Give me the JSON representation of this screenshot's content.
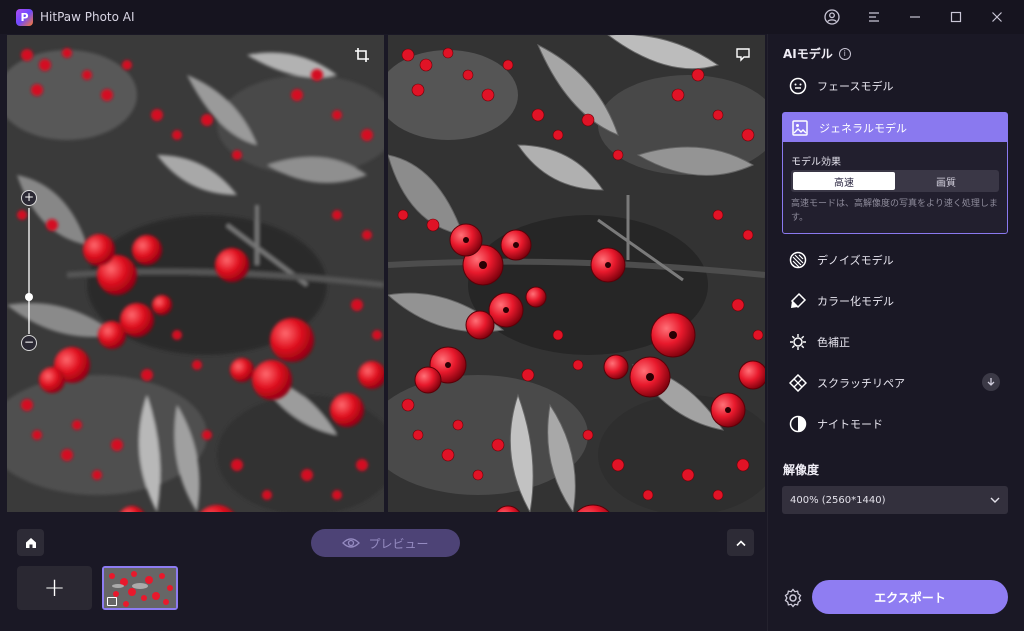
{
  "app": {
    "title": "HitPaw Photo AI",
    "logo_letter": "P"
  },
  "titlebar": {
    "icons": [
      "user-icon",
      "menu-icon",
      "minimize-icon",
      "maximize-icon",
      "close-icon"
    ]
  },
  "toolbar": {
    "preview_label": "プレビュー",
    "add_label": "+"
  },
  "sidebar": {
    "title": "AIモデル",
    "info_symbol": "i",
    "models": [
      {
        "label": "フェースモデル",
        "icon": "face-icon"
      },
      {
        "label": "ジェネラルモデル",
        "icon": "image-icon",
        "selected": true
      },
      {
        "label": "デノイズモデル",
        "icon": "denoise-icon"
      },
      {
        "label": "カラー化モデル",
        "icon": "colorize-icon"
      },
      {
        "label": "色補正",
        "icon": "color-correct-icon"
      },
      {
        "label": "スクラッチリペア",
        "icon": "scratch-icon"
      },
      {
        "label": "ナイトモード",
        "icon": "night-icon"
      }
    ],
    "effect": {
      "label": "モデル効果",
      "options": [
        "高速",
        "画質"
      ],
      "selected": "高速",
      "description": "高速モードは、高解像度の写真をより速く処理します。"
    },
    "resolution": {
      "label": "解像度",
      "value": "400% (2560*1440)"
    },
    "export_label": "エクスポート"
  },
  "colors": {
    "accent": "#8a79ef",
    "background": "#1a1825",
    "berry_red": "#e8192c"
  }
}
